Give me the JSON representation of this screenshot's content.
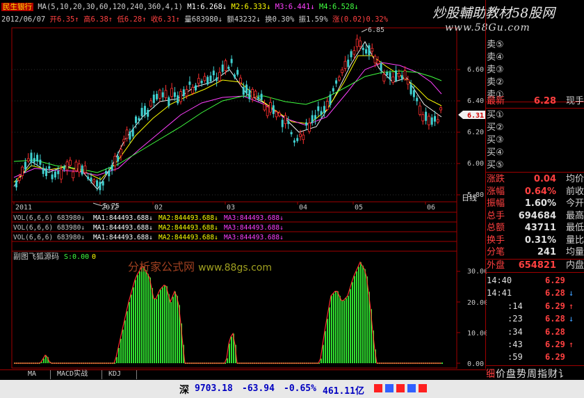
{
  "header": {
    "symbol": "民生银行",
    "ma_params": "MA(5,10,20,30,60,120,240,360,4,1)",
    "m1": "M1:6.268↓",
    "m2": "M2:6.333↓",
    "m3": "M3:6.441↓",
    "m4": "M4:6.528↓",
    "date": "2012/06/07",
    "open": "开6.35↑",
    "high": "高6.38↑",
    "low": "低6.28↑",
    "close": "收6.31↑",
    "volume": "量683980↓",
    "amount": "额43232↓",
    "turnover": "换0.30%",
    "amplitude": "振1.59%",
    "change": "涨(0.02)0.32%"
  },
  "watermarks": {
    "top": "炒股輔助教材58股网",
    "top_url": "www.58Gu.com",
    "mid": "分析家公式网",
    "mid_url": "www.88gs.com"
  },
  "main_chart": {
    "price_ticks": [
      "6.60",
      "6.40",
      "6.20",
      "6.00",
      "5.80"
    ],
    "current_price_tag": "6.31",
    "max_label": "6.85",
    "min_label": "5.75",
    "date_labels": [
      "2011",
      "2012",
      "02",
      "03",
      "04",
      "05",
      "06"
    ],
    "period": "日线"
  },
  "vol_rows": [
    {
      "a": "VOL(6,6,6)",
      "b": "683980↓",
      "c": "MA1:844493.688↓",
      "d": "MA2:844493.688↓",
      "e": "MA3:844493.688↓"
    },
    {
      "a": "VOL(6,6,6)",
      "b": "683980↓",
      "c": "MA1:844493.688↓",
      "d": "MA2:844493.688↓",
      "e": "MA3:844493.688↓"
    },
    {
      "a": "VOL(6,6,6)",
      "b": "683980↓",
      "c": "MA1:844493.688↓",
      "d": "MA2:844493.688↓",
      "e": "MA3:844493.688↓"
    }
  ],
  "sub_chart": {
    "title": "副图飞狐源码",
    "s_label": "S:0.00",
    "o_label": "0",
    "ticks": [
      "30.00",
      "20.00",
      "10.00",
      "0.00"
    ]
  },
  "quote_panel": {
    "sell_rows": [
      "卖⑤",
      "卖④",
      "卖③",
      "卖②",
      "卖①"
    ],
    "latest_label": "最新",
    "latest_value": "6.28",
    "latest_right": "现手",
    "buy_rows": [
      "买①",
      "买②",
      "买③",
      "买④",
      "买⑤"
    ],
    "stats": [
      {
        "label": "涨跌",
        "value": "0.04",
        "right": "均价",
        "color": "#ff4040"
      },
      {
        "label": "涨幅",
        "value": "0.64%",
        "right": "前收",
        "color": "#ff4040"
      },
      {
        "label": "振幅",
        "value": "1.60%",
        "right": "今开",
        "color": "#e0e0e0"
      },
      {
        "label": "总手",
        "value": "694684",
        "right": "最高",
        "color": "#e0e0e0"
      },
      {
        "label": "总额",
        "value": "43711",
        "right": "最低",
        "color": "#e0e0e0"
      },
      {
        "label": "换手",
        "value": "0.31%",
        "right": "量比",
        "color": "#e0e0e0"
      },
      {
        "label": "分笔",
        "value": "241",
        "right": "均量",
        "color": "#e0e0e0"
      }
    ],
    "outer_label": "外盘",
    "outer_value": "654821",
    "inner_label": "内盘",
    "ticks": [
      {
        "time": "14:40",
        "price": "6.29",
        "arrow": ""
      },
      {
        "time": "14:41",
        "price": "6.28",
        "arrow": "↓"
      },
      {
        "time": ":14",
        "price": "6.29",
        "arrow": "↑"
      },
      {
        "time": ":23",
        "price": "6.28",
        "arrow": "↓"
      },
      {
        "time": ":34",
        "price": "6.28",
        "arrow": ""
      },
      {
        "time": ":43",
        "price": "6.29",
        "arrow": "↑"
      },
      {
        "time": ":59",
        "price": "6.29",
        "arrow": ""
      }
    ],
    "bottom_tabs": [
      "细",
      "价",
      "盘",
      "势",
      "周",
      "指",
      "财",
      "讠"
    ]
  },
  "bottom_tabs": [
    "MA",
    "MACD实战",
    "KDJ"
  ],
  "status": {
    "index_label": "深",
    "index_value": "9703.18",
    "change": "-63.94",
    "pct": "-0.65%",
    "amount": "461.11亿"
  }
}
